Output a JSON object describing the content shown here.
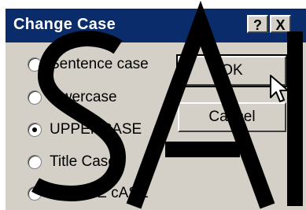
{
  "dialog": {
    "title": "Change Case",
    "help_button": "?",
    "close_button": "X"
  },
  "options": [
    {
      "label": "Sentence case",
      "checked": false
    },
    {
      "label": "lowercase",
      "checked": false
    },
    {
      "label": "UPPERCASE",
      "checked": true
    },
    {
      "label": "Title Case",
      "checked": false
    },
    {
      "label": "tOGGLE cASE",
      "checked": false
    }
  ],
  "buttons": {
    "ok": "OK",
    "cancel": "Cancel"
  },
  "colors": {
    "titlebar": "#0a2c6b",
    "dialog_bg": "#d4d0c8",
    "watermark": "#000000"
  },
  "watermark_text": "SAI"
}
